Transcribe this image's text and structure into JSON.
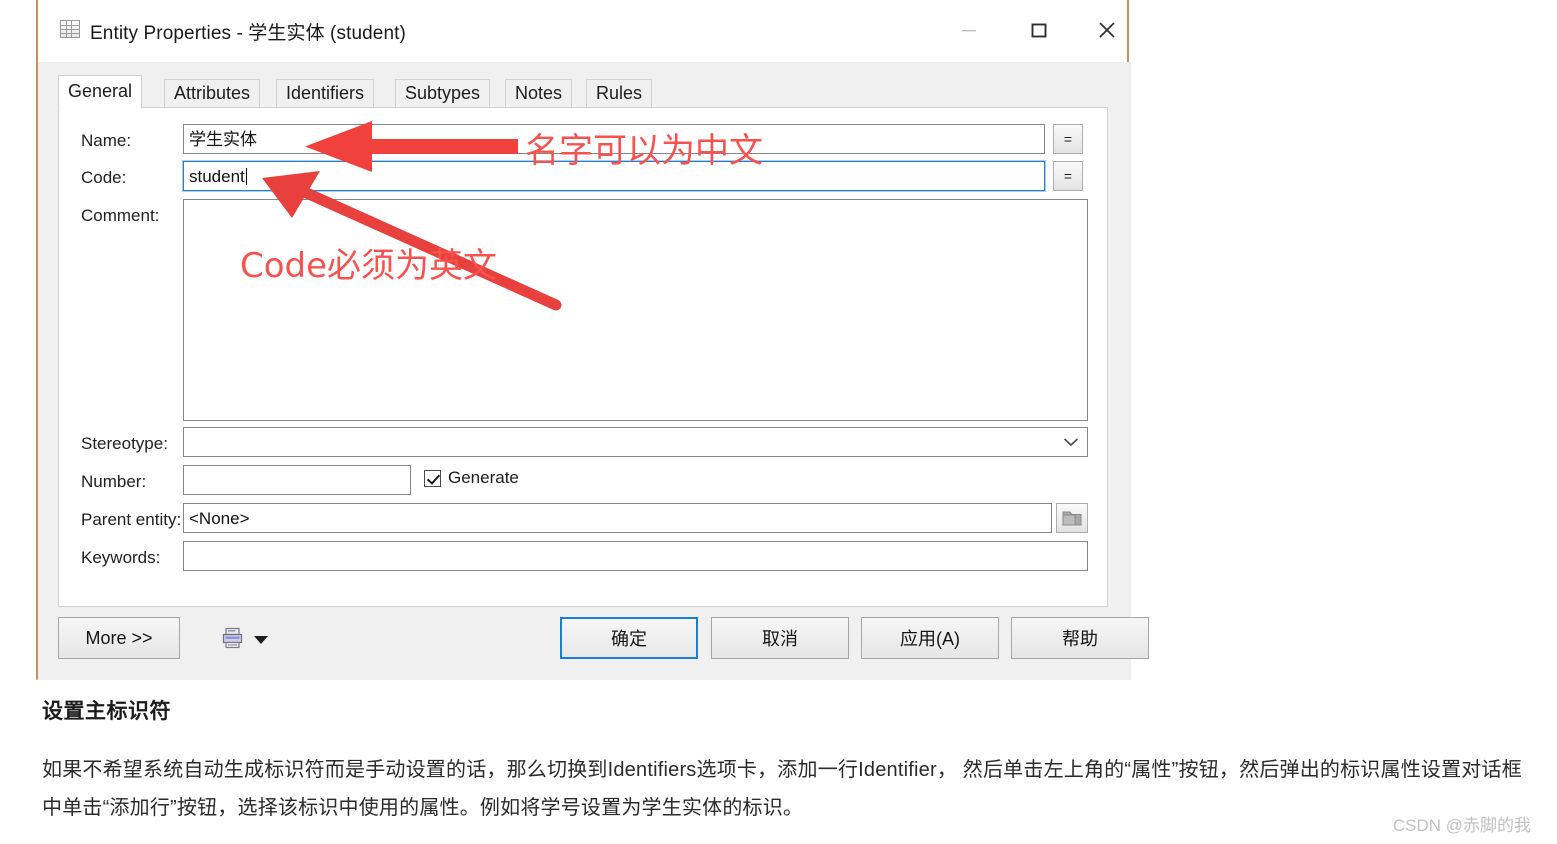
{
  "window": {
    "title": "Entity Properties - 学生实体 (student)",
    "icon": "grid-table-icon",
    "controls": {
      "minimize": "minimize-icon",
      "maximize": "maximize-icon",
      "close": "close-icon"
    }
  },
  "tabs": [
    {
      "label": "General",
      "active": true
    },
    {
      "label": "Attributes",
      "active": false
    },
    {
      "label": "Identifiers",
      "active": false
    },
    {
      "label": "Subtypes",
      "active": false
    },
    {
      "label": "Notes",
      "active": false
    },
    {
      "label": "Rules",
      "active": false
    }
  ],
  "form": {
    "name": {
      "label": "Name:",
      "value": "学生实体",
      "button": "="
    },
    "code": {
      "label": "Code:",
      "value": "student",
      "button": "=",
      "focused": true
    },
    "comment": {
      "label": "Comment:",
      "value": ""
    },
    "stereotype": {
      "label": "Stereotype:",
      "value": ""
    },
    "number": {
      "label": "Number:",
      "value": ""
    },
    "generate": {
      "label": "Generate",
      "checked": true
    },
    "parent_entity": {
      "label": "Parent entity:",
      "value": "<None>"
    },
    "keywords": {
      "label": "Keywords:",
      "value": ""
    }
  },
  "footer": {
    "more": "More >>",
    "print_icon": "printer-icon",
    "print_dropdown": "chevron-down-icon",
    "ok": "确定",
    "cancel": "取消",
    "apply": "应用(A)",
    "help": "帮助"
  },
  "annotations": {
    "color": "#f8524e",
    "name_note": "名字可以为中文",
    "code_note": "Code必须为英文"
  },
  "article": {
    "heading": "设置主标识符",
    "paragraph": "如果不希望系统自动生成标识符而是手动设置的话，那么切换到Identifiers选项卡，添加一行Identifier， 然后单击左上角的“属性”按钮，然后弹出的标识属性设置对话框中单击“添加行”按钮，选择该标识中使用的属性。例如将学号设置为学生实体的标识。"
  },
  "watermark": "CSDN @赤脚的我"
}
